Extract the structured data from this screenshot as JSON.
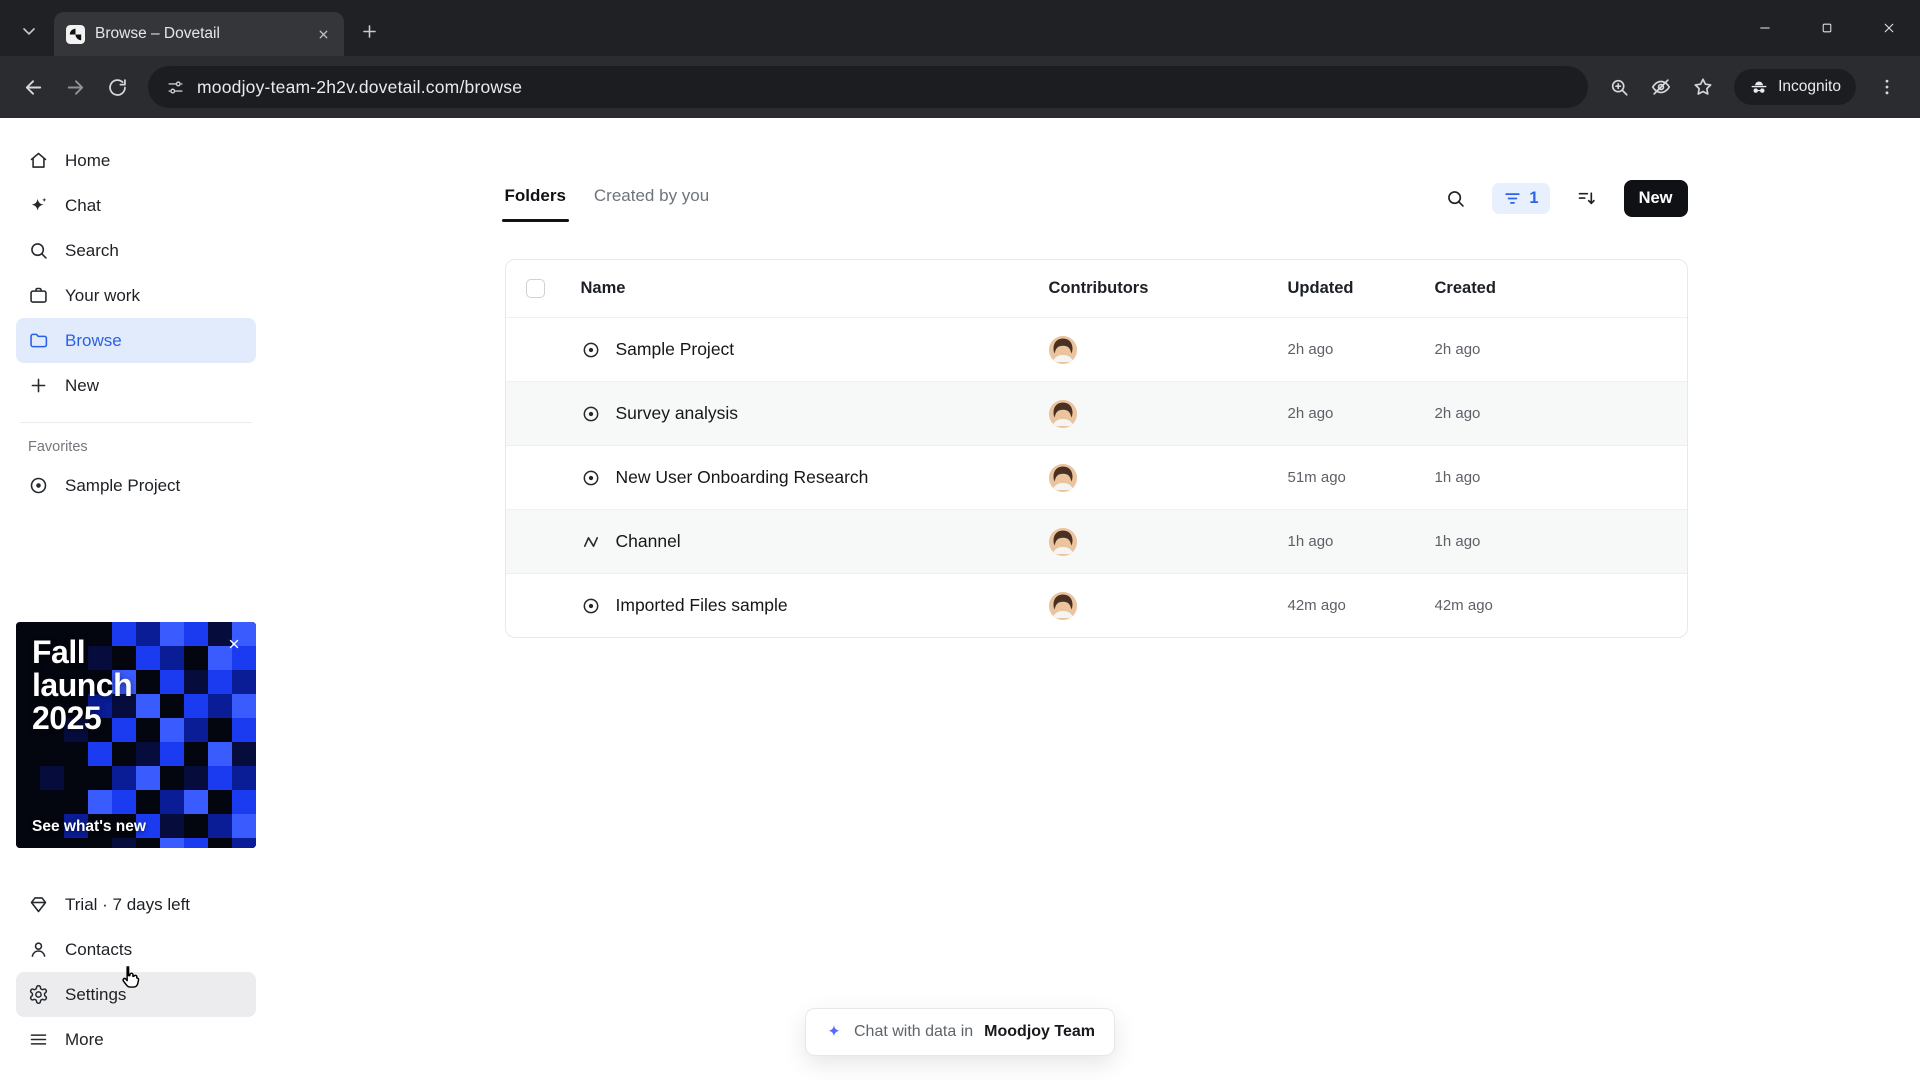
{
  "browser": {
    "tab_title": "Browse – Dovetail",
    "url": "moodjoy-team-2h2v.dovetail.com/browse",
    "incognito_label": "Incognito"
  },
  "sidebar": {
    "items": [
      {
        "label": "Home"
      },
      {
        "label": "Chat"
      },
      {
        "label": "Search"
      },
      {
        "label": "Your work"
      },
      {
        "label": "Browse"
      },
      {
        "label": "New"
      }
    ],
    "favorites_label": "Favorites",
    "favorites": [
      {
        "label": "Sample Project"
      }
    ],
    "promo": {
      "title": "Fall launch 2025",
      "cta": "See what's new"
    },
    "footer_items": [
      {
        "label": "Trial · 7 days left"
      },
      {
        "label": "Contacts"
      },
      {
        "label": "Settings"
      },
      {
        "label": "More"
      }
    ]
  },
  "main": {
    "tabs": [
      {
        "label": "Folders"
      },
      {
        "label": "Created by you"
      }
    ],
    "filter_count": "1",
    "new_button_label": "New",
    "table": {
      "headers": {
        "name": "Name",
        "contributors": "Contributors",
        "updated": "Updated",
        "created": "Created"
      },
      "rows": [
        {
          "name": "Sample Project",
          "updated": "2h ago",
          "created": "2h ago"
        },
        {
          "name": "Survey analysis",
          "updated": "2h ago",
          "created": "2h ago"
        },
        {
          "name": "New User Onboarding Research",
          "updated": "51m ago",
          "created": "1h ago"
        },
        {
          "name": "Channel",
          "updated": "1h ago",
          "created": "1h ago"
        },
        {
          "name": "Imported Files sample",
          "updated": "42m ago",
          "created": "42m ago"
        }
      ]
    },
    "chat_pill": {
      "prefix": "Chat with data in",
      "team": "Moodjoy Team"
    }
  }
}
